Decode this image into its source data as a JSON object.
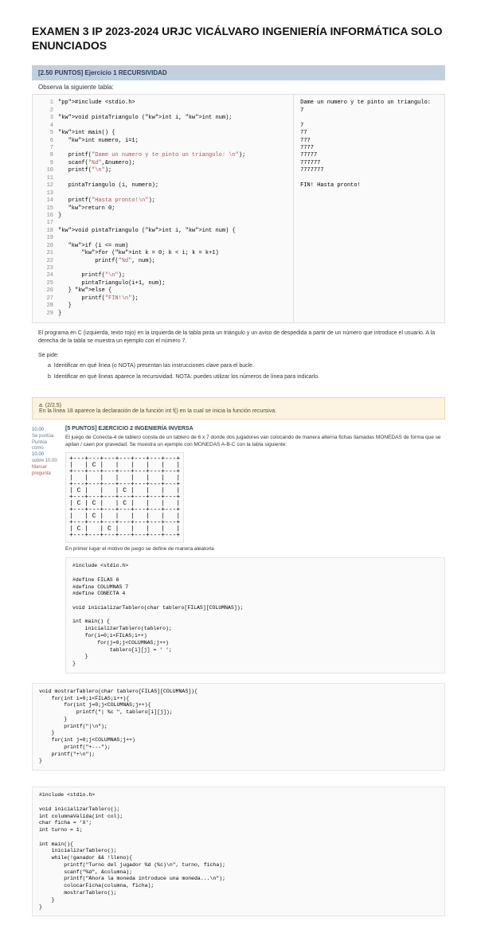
{
  "title": "EXAMEN 3 IP 2023-2024 URJC VICÁLVARO INGENIERÍA INFORMÁTICA SOLO ENUNCIADOS",
  "section1": {
    "header": "[2.50 PUNTOS] Ejercicio 1 RECURSIVIDAD",
    "observe": "Observa la siguiente tabla:",
    "code_left": "#include <stdio.h>\n\nvoid pintaTriangulo (int i, int num);\n\nint main() {\n   int numero, i=1;\n\n   printf(\"Dame un numero y te pinto un triangulo: \\n\");\n   scanf(\"%d\",&numero);\n   printf(\"\\n\");\n\n   pintaTriangulo (i, numero);\n\n   printf(\"Hasta pronto!\\n\");\n   return 0;\n}\n\nvoid pintaTriangulo (int i, int num) {\n\n   if (i <= num)\n       for (int k = 0; k < i; k = k+1)\n           printf(\"%d\", num);\n\n       printf(\"\\n\");\n       pintaTriangulo(i+1, num);\n   } else {\n       printf(\"FIN!\\n\");\n   }\n}",
    "code_right": "Dame un numero y te pinto un triangulo:\n7\n\n7\n77\n777\n7777\n77777\n777777\n7777777\n\nFIN! Hasta pronto!"
  },
  "explain": {
    "p1": "El programa en C (izquierda, texto rojo) en la izquierda de la tabla pinta un triángulo y un aviso de despedida a partir de un número que introduce el usuario. A la derecha de la tabla se muestra un ejemplo con el número 7.",
    "sub": "Se pide:",
    "b1": "Identificar en qué línea (o NOTA) presentan las instrucciones clave para el bucle.",
    "b2": "Identificar en qué líneas aparece la recursividad. NOTA: puedes utilizar los números de línea para indicarlo."
  },
  "warn": {
    "label": "a. (2/2.5)",
    "text": "En la línea 18 aparece la declaración de la función int f() en la cual se inicia la función recursiva."
  },
  "score": {
    "l1": "10.00",
    "l2": "Se puntúa",
    "l3": "Puntúa como",
    "l4": "10.00",
    "l5": "sobre 10.00",
    "flag": "Marcar pregunta"
  },
  "q2": {
    "title": "[5 PUNTOS] EJERCICIO 2 INGENIERÍA INVERSA",
    "text": "El juego de Conecta-4 de tablero consta de un tablero de 6 x 7 donde dos jugadores van colocando de manera alterna fichas llamadas MONEDAS de forma que se apilan / caen por gravedad. Se muestra un ejemplo con MONEDAS A-B-C con la tabla siguiente:",
    "board": "+---+---+---+---+---+---+---+\n|   | C |   |   |   |   |   |\n+---+---+---+---+---+---+---+\n|   |   |   |   |   |   |   |\n+---+---+---+---+---+---+---+\n| C |   |   | C |   |   |   |\n+---+---+---+---+---+---+---+\n| C | C |   | C |   |   |   |\n+---+---+---+---+---+---+---+\n|   | C |   |   |   |   |   |\n+---+---+---+---+---+---+---+\n| C |   | C |   |   |   |   |\n+---+---+---+---+---+---+---+",
    "text2": "En primer lugar el motivo de juego se define de manera aleatoria",
    "code1": "#include <stdio.h>\n\n#define FILAS 6\n#define COLUMNAS 7\n#define CONECTA 4\n\nvoid inicializarTablero(char tablero[FILAS][COLUMNAS]);\n\nint main() {\n    inicializarTablero(tablero);\n    for(i=0;i<FILAS;i++)\n        for(j=0;j<COLUMNAS;j++)\n            tablero[i][j] = ' ';\n    }\n}",
    "code2": "void mostrarTablero(char tablero[FILAS][COLUMNAS]){\n    for(int i=0;i<FILAS;i++){\n        for(int j=0;j<COLUMNAS;j++){\n            printf(\"| %c \", tablero[i][j]);\n        }\n        printf(\"|\\n\");\n    }\n    for(int j=0;j<COLUMNAS;j++)\n        printf(\"+---\");\n    printf(\"+\\n\");\n}",
    "code3": "#include <stdio.h>\n\nvoid inicializarTablero();\nint columnaValida(int col);\nchar ficha = 'X';\nint turno = 1;\n\nint main(){\n    inicializarTablero();\n    while(!ganador && !lleno){\n        printf(\"Turno del jugador %d (%c)\\n\", turno, ficha);\n        scanf(\"%d\", &columna);\n        printf(\"Ahora la moneda introduce una moneda...\\n\");\n        colocarFicha(columna, ficha);\n        mostrarTablero();\n    }\n}"
  }
}
